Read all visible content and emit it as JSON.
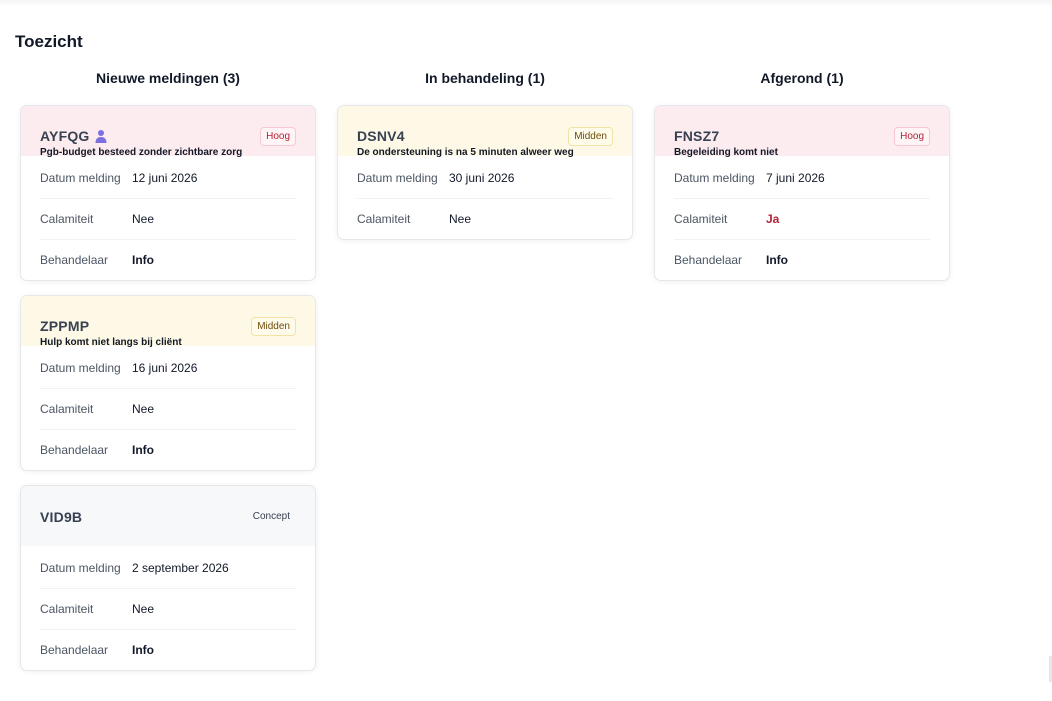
{
  "page": {
    "title": "Toezicht"
  },
  "labels": {
    "datum": "Datum melding",
    "calamiteit": "Calamiteit",
    "behandelaar": "Behandelaar"
  },
  "colors": {
    "hoog_bg": "#fdecef",
    "midden_bg": "#fdf9e6",
    "concept_bg": "#f7f8fa",
    "alert": "#b42338",
    "icon": "#7c6fe0"
  },
  "columns": [
    {
      "header": "Nieuwe meldingen (3)",
      "cards": [
        {
          "code": "AYFQG",
          "has_person_icon": true,
          "title": "Pgb-budget besteed zonder zichtbare zorg",
          "priority": "Hoog",
          "datum": "12 juni 2026",
          "calamiteit": "Nee",
          "behandelaar": "Info"
        },
        {
          "code": "ZPPMP",
          "title": "Hulp komt niet langs bij cliënt",
          "priority": "Midden",
          "datum": "16 juni 2026",
          "calamiteit": "Nee",
          "behandelaar": "Info"
        },
        {
          "code": "VID9B",
          "title": "",
          "priority": "Concept",
          "datum": "2 september 2026",
          "calamiteit": "Nee",
          "behandelaar": "Info"
        }
      ]
    },
    {
      "header": "In behandeling (1)",
      "cards": [
        {
          "code": "DSNV4",
          "title": "De ondersteuning is na 5 minuten alweer weg",
          "priority": "Midden",
          "datum": "30 juni 2026",
          "calamiteit": "Nee"
        }
      ]
    },
    {
      "header": "Afgerond (1)",
      "cards": [
        {
          "code": "FNSZ7",
          "title": "Begeleiding komt niet",
          "priority": "Hoog",
          "datum": "7 juni 2026",
          "calamiteit": "Ja",
          "behandelaar": "Info"
        }
      ]
    }
  ]
}
